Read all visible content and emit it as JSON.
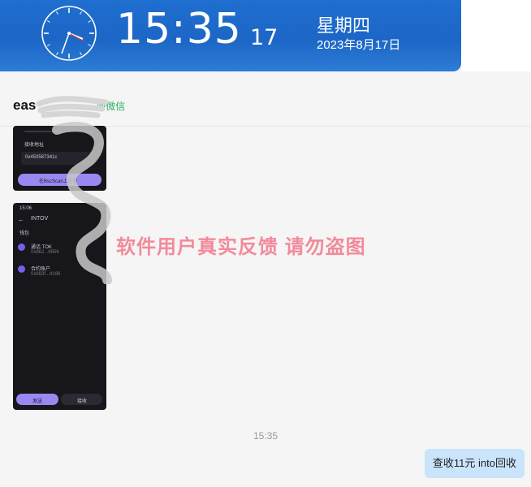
{
  "clock": {
    "time": "15:35",
    "seconds": "17",
    "weekday": "星期四",
    "date": "2023年8月17日"
  },
  "chat": {
    "contact_name": "eas",
    "contact_source": "@微信",
    "watermark": "软件用户真实反馈  请勿盗图",
    "timestamp": "15:35",
    "messages": [
      {
        "type": "image",
        "from": "contact"
      },
      {
        "type": "image",
        "from": "contact"
      },
      {
        "type": "text",
        "from": "me",
        "text": "查收11元 into回收"
      }
    ]
  },
  "phone_screenshot": {
    "status_time": "15:06",
    "title": "INTOV",
    "section": "钱包",
    "row1_name": "通话 TOK",
    "row1_addr": "0x862...8956",
    "row2_name": "合约账户",
    "row2_addr": "0x883f...4196",
    "btn_primary": "发送",
    "btn_secondary": "接收",
    "img1_label": "接收地址",
    "img1_addr": "0x450587341c",
    "img1_btn": "在BscScan上查看"
  },
  "colors": {
    "clock_bg": "#1f6fd0",
    "bubble_bg": "#c9e4fb",
    "source_green": "#2aae67",
    "watermark": "#f28a9a",
    "phone_accent": "#9b87f0"
  }
}
